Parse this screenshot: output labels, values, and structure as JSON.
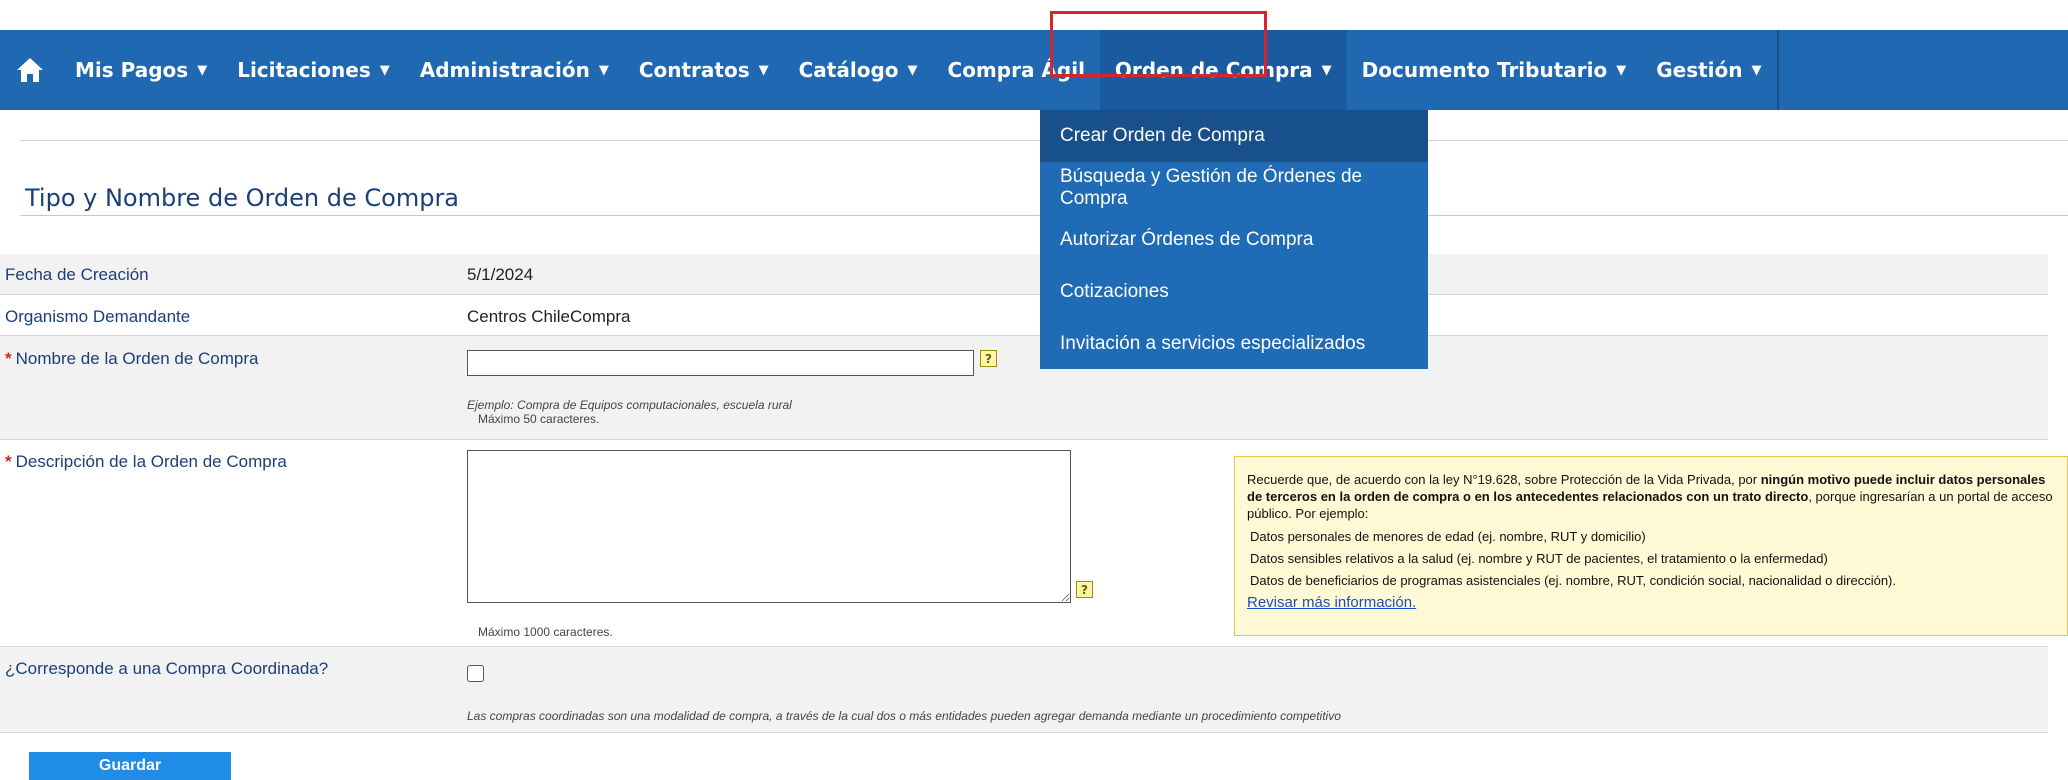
{
  "nav": {
    "items": [
      {
        "label": "Mis Pagos",
        "caret": "▼"
      },
      {
        "label": "Licitaciones",
        "caret": "▼"
      },
      {
        "label": "Administración",
        "caret": "▼"
      },
      {
        "label": "Contratos",
        "caret": "▼"
      },
      {
        "label": "Catálogo",
        "caret": "▼"
      },
      {
        "label": "Compra Ágil",
        "caret": ""
      },
      {
        "label": "Orden de Compra",
        "caret": "▼"
      },
      {
        "label": "Documento Tributario",
        "caret": "▼"
      },
      {
        "label": "Gestión",
        "caret": "▼"
      }
    ],
    "home_icon": "home-icon"
  },
  "dropdown": {
    "items": [
      "Crear Orden de Compra",
      "Búsqueda y Gestión de Órdenes de Compra",
      "Autorizar Órdenes de Compra",
      "Cotizaciones",
      "Invitación a servicios especializados"
    ]
  },
  "page": {
    "section_title": "Tipo y Nombre de Orden de Compra"
  },
  "form": {
    "fecha_label": "Fecha de Creación",
    "fecha_value": "5/1/2024",
    "organismo_label": "Organismo Demandante",
    "organismo_value": "Centros ChileCompra",
    "nombre_label": "Nombre de la Orden de Compra",
    "nombre_value": "",
    "nombre_hint": "Ejemplo: Compra de Equipos computacionales, escuela rural",
    "nombre_max": "Máximo 50 caracteres.",
    "descripcion_label": "Descripción de la Orden de Compra",
    "descripcion_value": "",
    "descripcion_max": "Máximo 1000 caracteres.",
    "coordinada_label": "¿Corresponde a una Compra Coordinada?",
    "coordinada_hint": "Las compras coordinadas son una modalidad de compra, a través de la cual dos o más entidades pueden agregar demanda mediante un procedimiento competitivo",
    "required_mark": "*",
    "help_mark": "?"
  },
  "notice": {
    "text_a": "Recuerde que, de acuerdo con la ley N°19.628, sobre Protección de la Vida Privada, por ",
    "text_bold": "ningún motivo puede incluir datos personales de terceros en la orden de compra o en los antecedentes relacionados con un trato directo",
    "text_b": ", porque ingresarían a un portal de acceso público. Por ejemplo:",
    "bullets": [
      "Datos personales de menores de edad (ej. nombre, RUT y domicilio)",
      "Datos sensibles relativos a la salud (ej. nombre y RUT de pacientes, el tratamiento o la enfermedad)",
      "Datos de beneficiarios de programas asistenciales (ej. nombre, RUT, condición social, nacionalidad o dirección)."
    ],
    "link": "Revisar más información."
  },
  "actions": {
    "save_label": "Guardar"
  },
  "colors": {
    "nav_bg": "#2068b2",
    "highlight": "#d6262a",
    "notice_bg": "#fff9d6"
  }
}
